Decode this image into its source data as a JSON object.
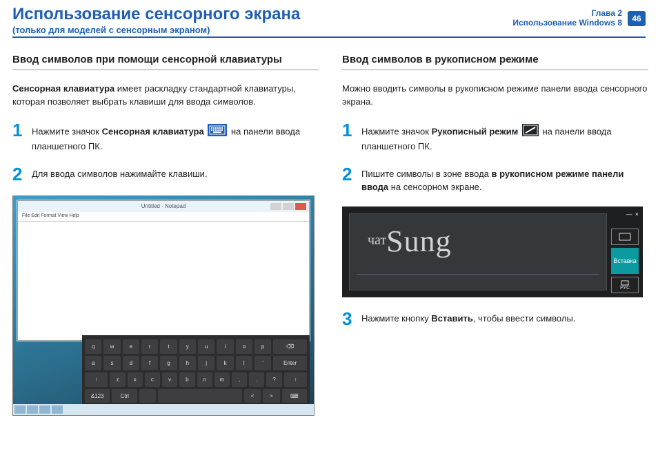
{
  "header": {
    "title": "Использование сенсорного экрана",
    "subtitle": "(только для моделей с сенсорным экраном)",
    "chapter_line1": "Глава 2",
    "chapter_line2": "Использование Windows 8",
    "page": "46"
  },
  "left": {
    "heading": "Ввод символов при помощи сенсорной клавиатуры",
    "intro_bold": "Сенсорная клавиатура",
    "intro_rest": " имеет раскладку стандартной клавиатуры, которая позволяет выбрать клавиши для ввода символов.",
    "step1_a": "Нажмите значок ",
    "step1_b": "Сенсорная клавиатура",
    "step1_c": " на панели ввода планшетного ПК.",
    "step2": "Для ввода символов нажимайте клавиши.",
    "notepad_title": "Untitled - Notepad",
    "notepad_menu": "File  Edit  Format  View  Help",
    "keyboard": {
      "row1": [
        "q",
        "w",
        "e",
        "r",
        "t",
        "y",
        "u",
        "i",
        "o",
        "p",
        "⌫"
      ],
      "row2": [
        "a",
        "s",
        "d",
        "f",
        "g",
        "h",
        "j",
        "k",
        "l",
        "'",
        "Enter"
      ],
      "row3": [
        "↑",
        "z",
        "x",
        "c",
        "v",
        "b",
        "n",
        "m",
        ",",
        ".",
        "?",
        "↑"
      ],
      "row4": [
        "&123",
        "Ctrl",
        "",
        "",
        "SPACE",
        "",
        "<",
        ">",
        "⌨"
      ]
    }
  },
  "right": {
    "heading": "Ввод символов в рукописном режиме",
    "intro": "Можно вводить символы в рукописном режиме панели ввода сенсорного экрана.",
    "step1_a": "Нажмите значок ",
    "step1_b": "Рукописный режим",
    "step1_c": " на панели ввода планшетного ПК.",
    "step2_a": "Пишите символы в зоне ввода ",
    "step2_b": "в рукописном режиме панели ввода",
    "step2_c": " на сенсорном экране.",
    "hw_prefix": "чат",
    "hw_script": "Sung",
    "insert_label": "Вставка",
    "lang_label": "РУС",
    "step3_a": "Нажмите кнопку ",
    "step3_b": "Вставить",
    "step3_c": ", чтобы ввести символы."
  },
  "nums": {
    "n1": "1",
    "n2": "2",
    "n3": "3"
  }
}
